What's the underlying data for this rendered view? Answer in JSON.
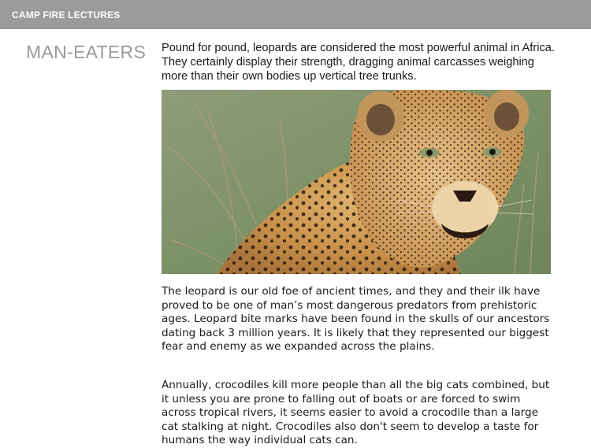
{
  "app_bar": {
    "title": "CAMP FIRE LECTURES"
  },
  "section": {
    "title": "MAN-EATERS"
  },
  "paragraphs": [
    "Pound for pound, leopards are considered the most powerful animal in Africa. They certainly display their strength, dragging animal carcasses weighing more than their own bodies up vertical tree trunks.",
    "The leopard is our old foe of ancient times, and they and their ilk have proved to be one of man’s most dangerous predators from prehistoric ages. Leopard bite marks have been found in the skulls of our ancestors dating back 3 million years. It is likely that they represented our biggest fear and enemy as we expanded across the plains.",
    "Annually, crocodiles kill more people than all the big cats combined, but it unless you are prone to falling out of boats or are forced to swim across tropical rivers, it seems easier to avoid a crocodile than a large cat stalking at night. Crocodiles also don't seem to develop a taste for humans the way individual cats can."
  ],
  "image": {
    "subject": "leopard-photo"
  },
  "colors": {
    "app_bar": "#9b9b9b",
    "section_title": "#9a9a9a",
    "body_text": "#1a1a1a"
  }
}
